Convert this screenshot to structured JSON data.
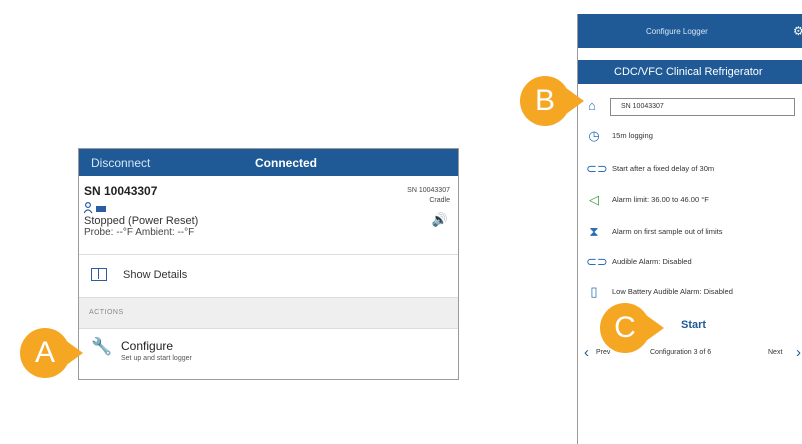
{
  "panel_a": {
    "topbar": {
      "disconnect": "Disconnect",
      "status": "Connected"
    },
    "device": {
      "serial": "SN 10043307",
      "serial_right": "SN 10043307",
      "cradle": "Cradle",
      "state": "Stopped (Power Reset)",
      "probe_ambient": "Probe: --°F Ambient: --°F"
    },
    "show_details": "Show Details",
    "actions_header": "ACTIONS",
    "configure": {
      "title": "Configure",
      "subtitle": "Set up and start logger"
    }
  },
  "panel_b": {
    "topbar_title": "Configure Logger",
    "profile_name": "CDC/VFC Clinical Refrigerator",
    "serial_field": "SN 10043307",
    "settings": [
      {
        "icon": "clock-icon",
        "text": "15m logging"
      },
      {
        "icon": "link-icon",
        "text": "Start after a fixed delay of 30m"
      },
      {
        "icon": "thermometer-icon",
        "text": "Alarm limit: 36.00 to 46.00 °F"
      },
      {
        "icon": "hourglass-icon",
        "text": "Alarm on first sample out of limits"
      },
      {
        "icon": "speaker-icon",
        "text": "Audible Alarm: Disabled"
      },
      {
        "icon": "battery-icon",
        "text": "Low Battery Audible Alarm: Disabled"
      }
    ],
    "start_label": "Start",
    "nav": {
      "prev": "Prev",
      "page": "Configuration 3 of 6",
      "next": "Next"
    }
  },
  "markers": {
    "a": "A",
    "b": "B",
    "c": "C"
  },
  "colors": {
    "header_blue": "#1f5a96",
    "marker_orange": "#f5a623",
    "icon_blue": "#2a6fb8"
  }
}
